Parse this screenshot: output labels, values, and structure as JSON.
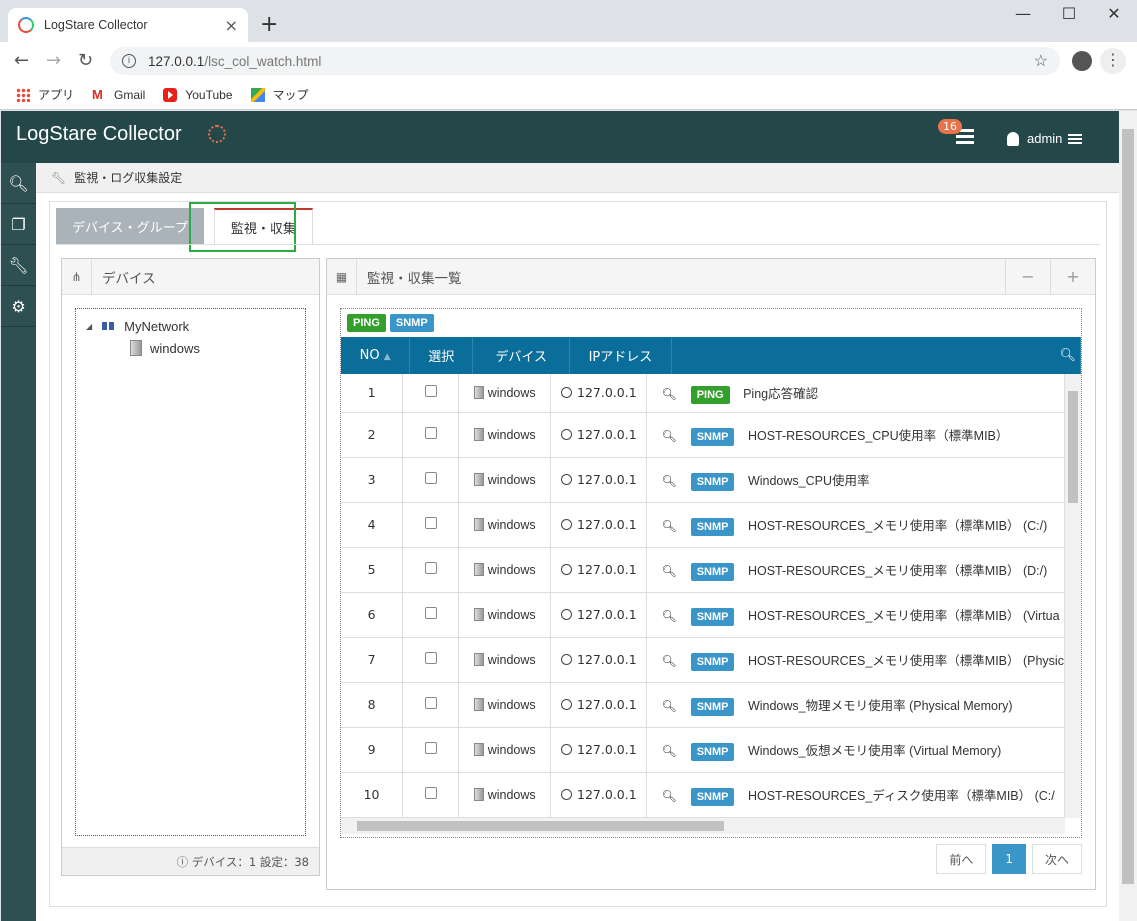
{
  "browser": {
    "tab_title": "LogStare Collector",
    "tab_close": "×",
    "new_tab": "+",
    "url_host": "127.0.0.1",
    "url_path": "/lsc_col_watch.html",
    "bookmarks": [
      "アプリ",
      "Gmail",
      "YouTube",
      "マップ"
    ]
  },
  "app": {
    "title": "LogStare Collector",
    "notification_count": "16",
    "user": "admin"
  },
  "breadcrumb": "監視・ログ収集設定",
  "tabs": [
    "デバイス・グループ",
    "監視・収集"
  ],
  "device_panel": {
    "title": "デバイス",
    "tree_root": "MyNetwork",
    "tree_child": "windows",
    "footer": "ⓘ デバイス：1 設定：38"
  },
  "list_panel": {
    "title": "監視・収集一覧",
    "minus": "−",
    "plus": "+",
    "filters": [
      "PING",
      "SNMP"
    ],
    "columns": [
      "NO",
      "選択",
      "デバイス",
      "IPアドレス"
    ],
    "rows": [
      {
        "no": "1",
        "device": "windows",
        "ip": "127.0.0.1",
        "type": "PING",
        "name": "Ping応答確認"
      },
      {
        "no": "2",
        "device": "windows",
        "ip": "127.0.0.1",
        "type": "SNMP",
        "name": "HOST-RESOURCES_CPU使用率（標準MIB）"
      },
      {
        "no": "3",
        "device": "windows",
        "ip": "127.0.0.1",
        "type": "SNMP",
        "name": "Windows_CPU使用率"
      },
      {
        "no": "4",
        "device": "windows",
        "ip": "127.0.0.1",
        "type": "SNMP",
        "name": "HOST-RESOURCES_メモリ使用率（標準MIB） (C:/)"
      },
      {
        "no": "5",
        "device": "windows",
        "ip": "127.0.0.1",
        "type": "SNMP",
        "name": "HOST-RESOURCES_メモリ使用率（標準MIB） (D:/)"
      },
      {
        "no": "6",
        "device": "windows",
        "ip": "127.0.0.1",
        "type": "SNMP",
        "name": "HOST-RESOURCES_メモリ使用率（標準MIB） (Virtua"
      },
      {
        "no": "7",
        "device": "windows",
        "ip": "127.0.0.1",
        "type": "SNMP",
        "name": "HOST-RESOURCES_メモリ使用率（標準MIB） (Physic"
      },
      {
        "no": "8",
        "device": "windows",
        "ip": "127.0.0.1",
        "type": "SNMP",
        "name": "Windows_物理メモリ使用率 (Physical Memory)"
      },
      {
        "no": "9",
        "device": "windows",
        "ip": "127.0.0.1",
        "type": "SNMP",
        "name": "Windows_仮想メモリ使用率 (Virtual Memory)"
      },
      {
        "no": "10",
        "device": "windows",
        "ip": "127.0.0.1",
        "type": "SNMP",
        "name": "HOST-RESOURCES_ディスク使用率（標準MIB） (C:/"
      }
    ],
    "pager": {
      "prev": "前へ",
      "page": "1",
      "next": "次へ"
    }
  },
  "colors": {
    "header": "#24474a",
    "sidebar": "#2e5052",
    "table_head": "#0b6e9a",
    "ping": "#33a02c",
    "snmp": "#3a95c8",
    "highlight": "#2eaa45"
  }
}
